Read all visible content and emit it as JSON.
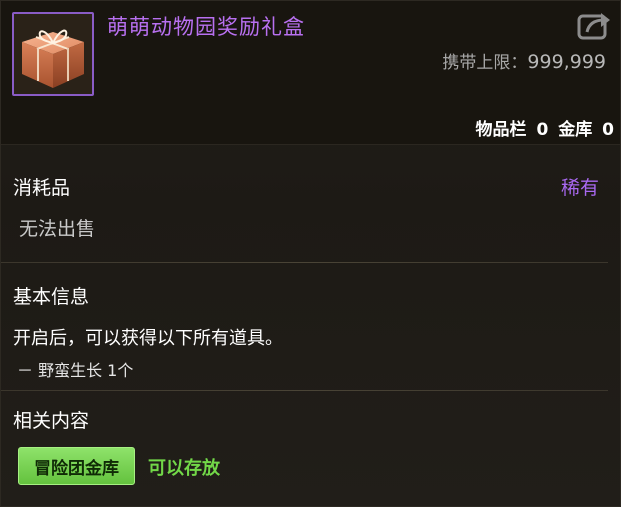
{
  "item": {
    "name": "萌萌动物园奖励礼盒",
    "carry_limit_label": "携带上限：",
    "carry_limit_value": "999,999",
    "inventory_label": "物品栏",
    "inventory_count": "0",
    "vault_label": "金库",
    "vault_count": "0"
  },
  "category": {
    "type": "消耗品",
    "rarity": "稀有",
    "sell_status": "无法出售"
  },
  "basic_info": {
    "title": "基本信息",
    "description": "开启后，可以获得以下所有道具。",
    "contents": [
      "－ 野蛮生长 1个"
    ]
  },
  "related": {
    "title": "相关内容",
    "button_label": "冒险团金库",
    "storable_text": "可以存放"
  },
  "colors": {
    "item_name": "#b870f0",
    "rarity": "#a868f0",
    "icon_border": "#8a5cc6",
    "green_button": "#6ccc44",
    "storable": "#72d848"
  },
  "icons": {
    "item": "gift-box-icon",
    "share": "share-icon"
  }
}
